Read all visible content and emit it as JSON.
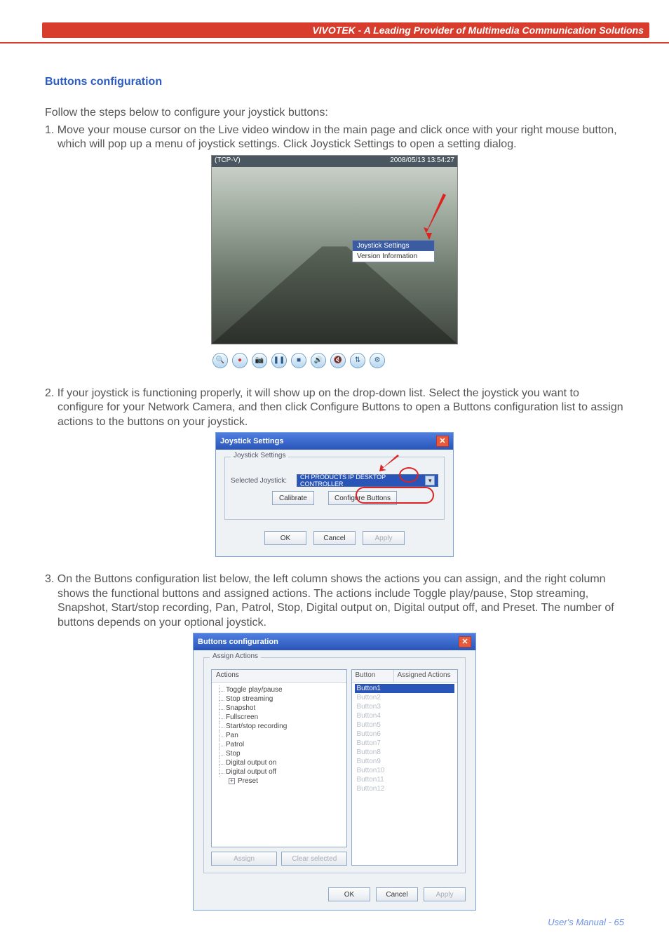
{
  "header": "VIVOTEK - A Leading Provider of Multimedia Communication Solutions",
  "section_title": "Buttons configuration",
  "intro": "Follow the steps below to configure your joystick buttons:",
  "step1": "1. Move your mouse cursor on the Live video window in the main page and click once with your right mouse button, which will pop up a menu of joystick settings. Click Joystick Settings to open a setting dialog.",
  "step2": "2. If your joystick is functioning properly, it will show up on the drop-down list. Select the joystick you want to configure for your Network Camera, and then click Configure Buttons to open a Buttons configuration list to assign actions to the buttons on your joystick.",
  "step3": "3. On the Buttons configuration list below, the left column shows the actions you can assign, and the right column shows the functional buttons and assigned actions. The actions include Toggle play/pause, Stop streaming, Snapshot, Start/stop recording, Pan, Patrol, Stop, Digital output on, Digital output off, and Preset. The number of buttons depends on your optional joystick.",
  "fig1": {
    "tl": "(TCP-V)",
    "tr": "2008/05/13 13:54:27",
    "menu1": "Joystick Settings",
    "menu2": "Version Information"
  },
  "dlg2": {
    "title": "Joystick Settings",
    "legend": "Joystick Settings",
    "label": "Selected Joystick:",
    "select": "CH PRODUCTS IP DESKTOP CONTROLLER",
    "calibrate": "Calibrate",
    "configure": "Configure Buttons",
    "ok": "OK",
    "cancel": "Cancel",
    "apply": "Apply"
  },
  "dlg3": {
    "title": "Buttons configuration",
    "legend": "Assign Actions",
    "hActions": "Actions",
    "hButton": "Button",
    "hAssigned": "Assigned Actions",
    "actions": [
      "Toggle play/pause",
      "Stop streaming",
      "Snapshot",
      "Fullscreen",
      "Start/stop recording",
      "Pan",
      "Patrol",
      "Stop",
      "Digital output on",
      "Digital output off"
    ],
    "preset": "Preset",
    "buttons": [
      "Button1",
      "Button2",
      "Button3",
      "Button4",
      "Button5",
      "Button6",
      "Button7",
      "Button8",
      "Button9",
      "Button10",
      "Button11",
      "Button12"
    ],
    "assign": "Assign",
    "clear": "Clear selected",
    "ok": "OK",
    "cancel": "Cancel",
    "apply": "Apply"
  },
  "footer": "User's Manual - 65"
}
